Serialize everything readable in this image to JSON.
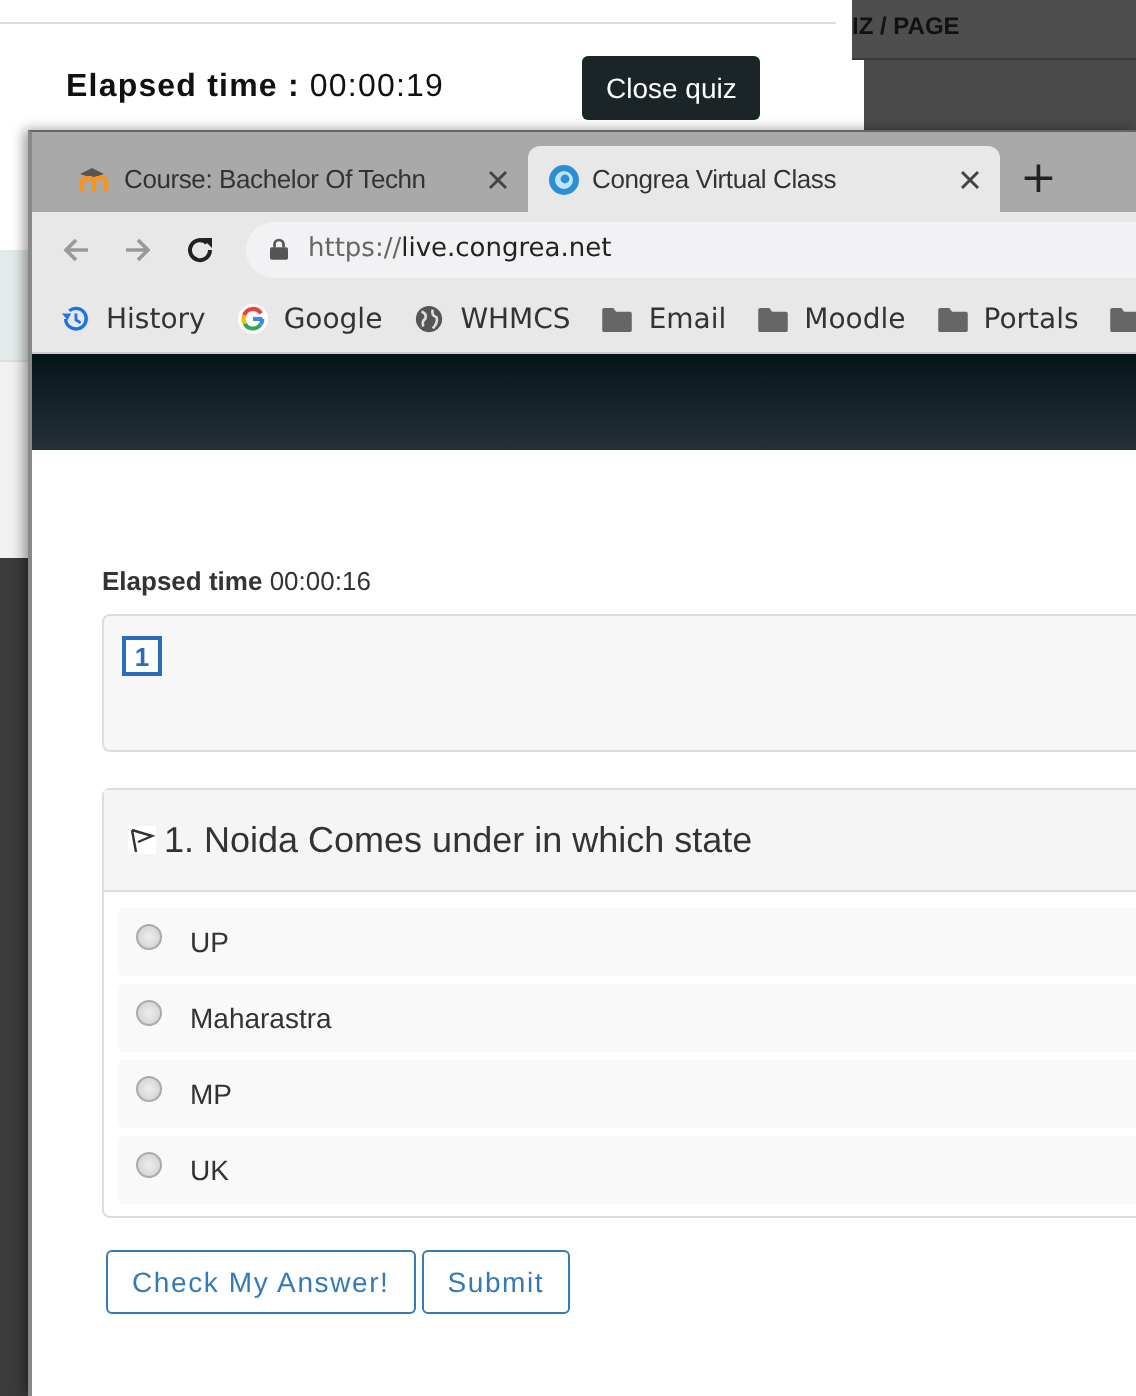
{
  "background_page": {
    "elapsed_label": "Elapsed time :",
    "elapsed_value": "00:00:19",
    "close_button": "Close quiz",
    "side_header": "IZ / PAGE"
  },
  "browser": {
    "tabs": [
      {
        "title": "Course: Bachelor Of Techn",
        "selected": false,
        "kind": "moodle"
      },
      {
        "title": "Congrea Virtual Class",
        "selected": true,
        "kind": "congrea"
      }
    ],
    "new_tab": "+",
    "url_scheme": "https://",
    "url_host": "live.congrea.net",
    "bookmarks": [
      {
        "label": "History",
        "kind": "history"
      },
      {
        "label": "Google",
        "kind": "google"
      },
      {
        "label": "WHMCS",
        "kind": "globe"
      },
      {
        "label": "Email",
        "kind": "folder"
      },
      {
        "label": "Moodle",
        "kind": "folder"
      },
      {
        "label": "Portals",
        "kind": "folder"
      },
      {
        "kind": "folder"
      }
    ]
  },
  "quiz": {
    "elapsed_label": "Elapsed time",
    "elapsed_value": "00:00:16",
    "question_nav": [
      {
        "label": "1",
        "selected": true
      }
    ],
    "question": "1. Noida Comes under in which state",
    "options": [
      {
        "label": "UP",
        "selected": false
      },
      {
        "label": "Maharastra",
        "selected": false
      },
      {
        "label": "MP",
        "selected": false
      },
      {
        "label": "UK",
        "selected": false
      }
    ],
    "buttons": [
      "Check My Answer!",
      "Submit"
    ]
  }
}
